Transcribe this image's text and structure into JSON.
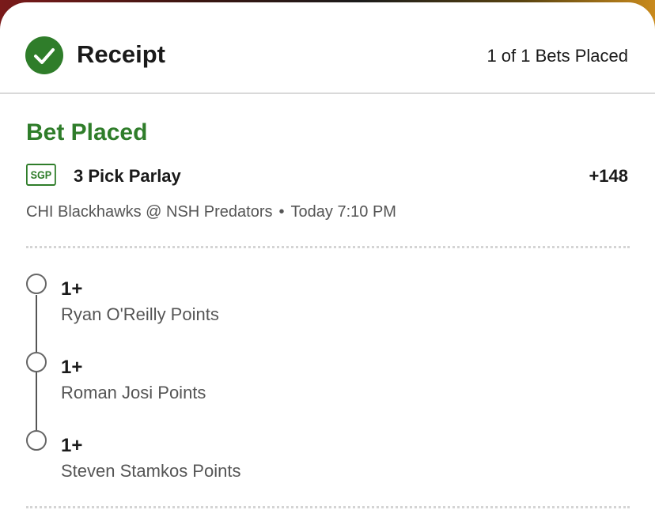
{
  "header": {
    "title": "Receipt",
    "count_text": "1 of 1 Bets Placed"
  },
  "bet": {
    "status": "Bet Placed",
    "badge": "SGP",
    "title": "3 Pick Parlay",
    "odds": "+148",
    "matchup": "CHI Blackhawks @ NSH Predators",
    "separator": "•",
    "time": "Today 7:10 PM"
  },
  "legs": [
    {
      "value": "1+",
      "market": "Ryan O'Reilly Points"
    },
    {
      "value": "1+",
      "market": "Roman Josi Points"
    },
    {
      "value": "1+",
      "market": "Steven Stamkos Points"
    }
  ],
  "colors": {
    "accent_green": "#2f7d2a",
    "text_primary": "#1a1a1a",
    "text_secondary": "#555555"
  },
  "icons": {
    "header": "check-circle-icon",
    "leg": "circle-outline-icon"
  }
}
